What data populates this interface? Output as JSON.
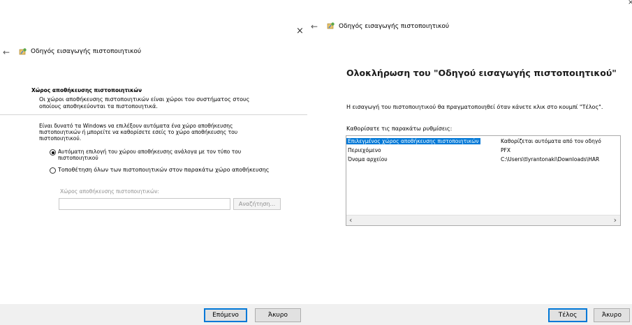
{
  "left": {
    "header_title": "Οδηγός εισαγωγής πιστοποιητικού",
    "section_title": "Χώρος αποθήκευσης πιστοποιητικών",
    "section_desc_1": "Οι χώροι αποθήκευσης πιστοποιητικών είναι χώροι του συστήματος στους",
    "section_desc_2": "οποίους αποθηκεύονται τα πιστοποιητικά.",
    "body_1": "Είναι δυνατό τα Windows να επιλέξουν αυτόματα ένα χώρο αποθήκευσης",
    "body_2": "πιστοποιητικών ή μπορείτε να καθορίσετε εσείς το χώρο αποθήκευσης του",
    "body_3": "πιστοποιητικού.",
    "radio_auto_1": "Αυτόματη επιλογή του χώρου αποθήκευσης ανάλογα με τον τύπο του",
    "radio_auto_2": "πιστοποιητικού",
    "radio_manual": "Τοποθέτηση όλων των πιστοποιητικών στον παρακάτω χώρο αποθήκευσης",
    "store_label": "Χώρος αποθήκευσης πιστοποιητικών:",
    "store_value": "",
    "browse_label": "Αναζήτηση...",
    "next_label": "Επόμενο",
    "cancel_label": "Άκυρο",
    "auto_selected": true
  },
  "right": {
    "header_title": "Οδηγός εισαγωγής πιστοποιητικού",
    "main_title": "Ολοκλήρωση του \"Οδηγού εισαγωγής πιστοποιητικού\"",
    "info_text": "Η εισαγωγή του πιστοποιητικού θα πραγματοποιηθεί όταν κάνετε κλικ στο κουμπί \"Τέλος\".",
    "settings_label": "Καθορίσατε τις παρακάτω ρυθμίσεις:",
    "rows": [
      {
        "name": "Επιλεγμένος χώρος αποθήκευσης πιστοποιητικών",
        "value": "Καθορίζεται αυτόματα από τον οδηγό",
        "selected": true
      },
      {
        "name": "Περιεχόμενο",
        "value": "PFX",
        "selected": false
      },
      {
        "name": "Όνομα αρχείου",
        "value": "C:\\Users\\tlyrantonaki\\Downloads\\HAR",
        "selected": false
      }
    ],
    "finish_label": "Τέλος",
    "cancel_label": "Άκυρο"
  },
  "glyphs": {
    "back_arrow": "←",
    "close": "×",
    "scroll_left": "‹",
    "scroll_right": "›"
  }
}
